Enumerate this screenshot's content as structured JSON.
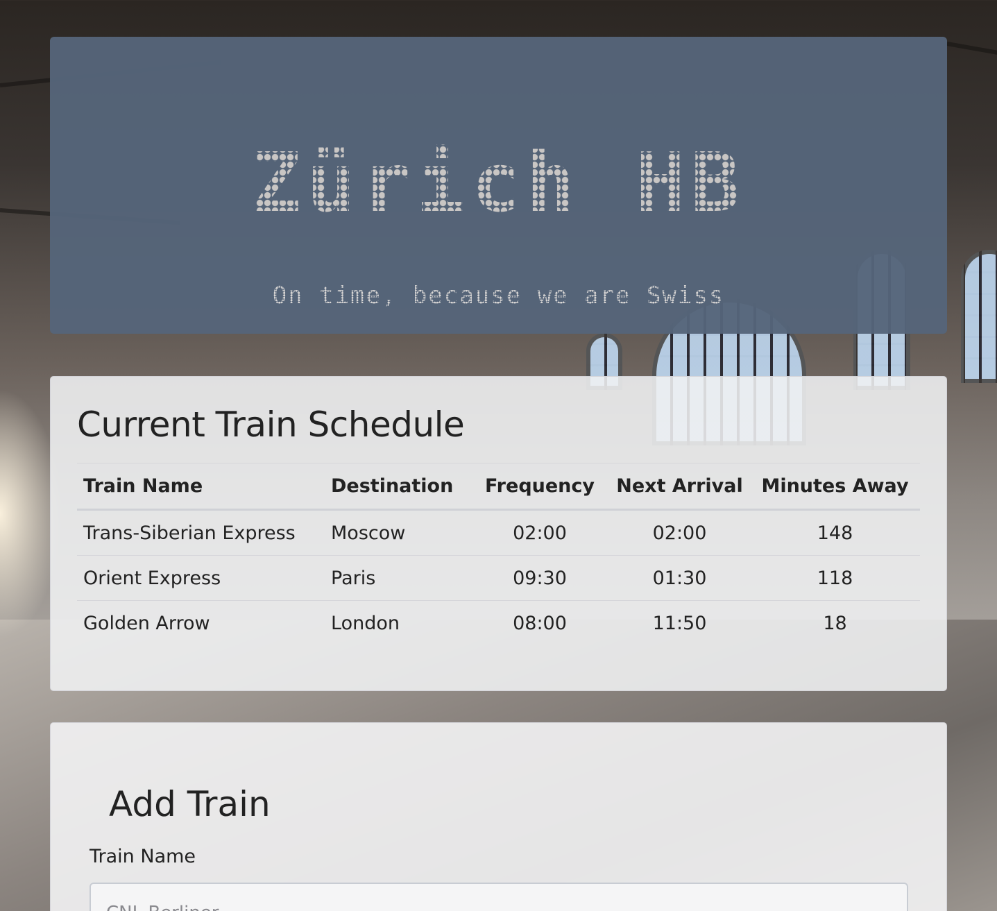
{
  "header": {
    "title": "Zürich HB",
    "subtitle": "On time, because we are Swiss"
  },
  "schedule": {
    "heading": "Current Train Schedule",
    "columns": [
      "Train Name",
      "Destination",
      "Frequency",
      "Next Arrival",
      "Minutes Away"
    ],
    "rows": [
      [
        "Trans-Siberian Express",
        "Moscow",
        "02:00",
        "02:00",
        "148"
      ],
      [
        "Orient Express",
        "Paris",
        "09:30",
        "01:30",
        "118"
      ],
      [
        "Golden Arrow",
        "London",
        "08:00",
        "11:50",
        "18"
      ]
    ]
  },
  "add_train": {
    "heading": "Add Train",
    "train_name_label": "Train Name",
    "train_name_placeholder": "CNL Berliner"
  }
}
